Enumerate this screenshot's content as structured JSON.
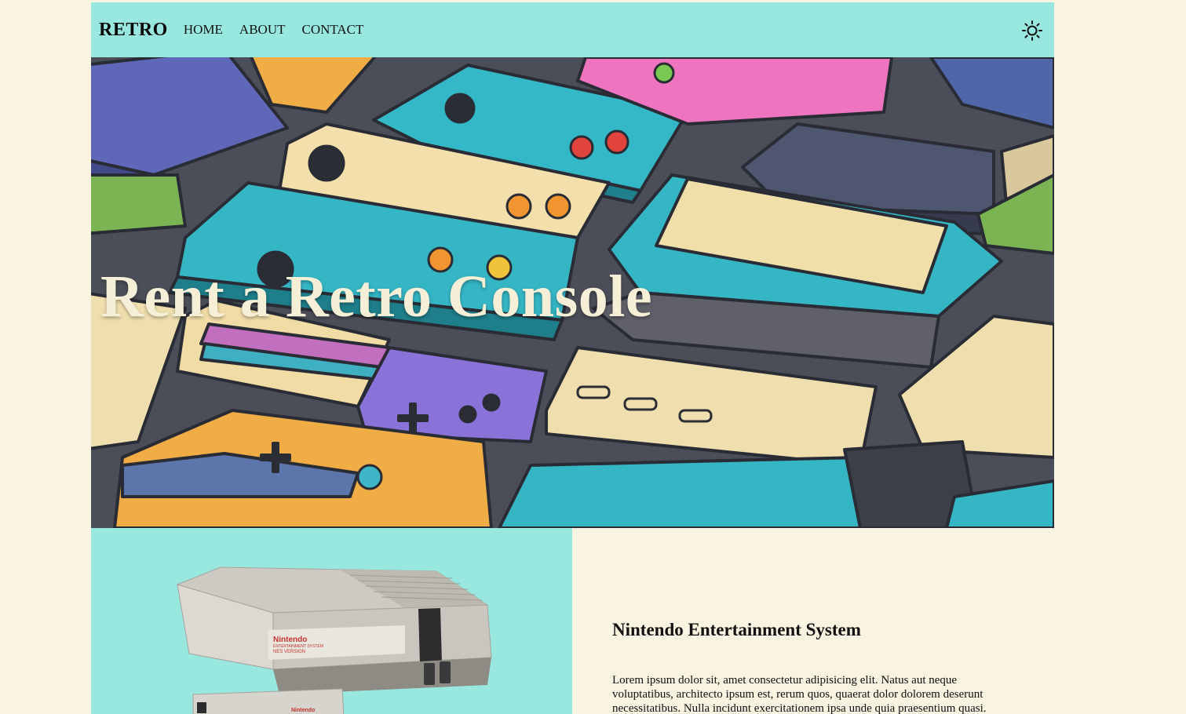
{
  "nav": {
    "brand": "RETRO",
    "links": [
      "HOME",
      "ABOUT",
      "CONTACT"
    ],
    "theme_icon": "sun-icon"
  },
  "hero": {
    "title": "Rent a Retro Console"
  },
  "product": {
    "title": "Nintendo Entertainment System",
    "description": "Lorem ipsum dolor sit, amet consectetur adipisicing elit. Natus aut neque voluptatibus, architecto ipsum est, rerum quos, quaerat dolor dolorem deserunt necessitatibus. Nulla incidunt exercitationem ipsa unde quia praesentium quasi.",
    "image_text": {
      "brand": "Nintendo",
      "line": "ENTERTAINMENT SYSTEM",
      "version": "NES VERSION",
      "controller_brand": "Nintendo"
    }
  },
  "colors": {
    "background": "#f8f4e1",
    "accent": "#98e8e0",
    "text": "#111111"
  }
}
